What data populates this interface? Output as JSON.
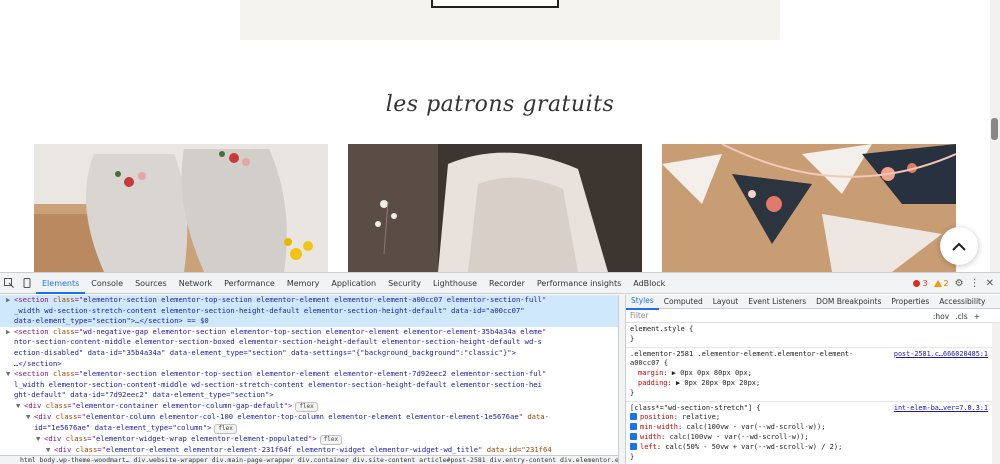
{
  "site": {
    "section_title": "les patrons gratuits",
    "cards": [
      {
        "name": "slippers"
      },
      {
        "name": "knitted-blanket"
      },
      {
        "name": "fabric-garland"
      }
    ],
    "up_icon": "chevron-up-icon"
  },
  "devtools": {
    "tabs": [
      "Elements",
      "Console",
      "Sources",
      "Network",
      "Performance",
      "Memory",
      "Application",
      "Security",
      "Lighthouse",
      "Recorder",
      "Performance insights",
      "AdBlock"
    ],
    "active_tab": "Elements",
    "error_count": "3",
    "warning_count": "2",
    "elements": [
      {
        "tri": "▶",
        "open": "<section ",
        "attrs": [
          [
            "class",
            "elementor-section elementor-top-section elementor-element elementor-element-a00cc07 elementor-section-full"
          ]
        ],
        "indent": 0,
        "selected": true
      },
      {
        "tri": "",
        "text": "_width wd-section-stretch-content elementor-section-height-default elementor-section-height-default\" data-id=\"a00cc07\"",
        "indent": 0,
        "selected": true
      },
      {
        "tri": "",
        "text": "data-element_type=\"section\">…</section> == $0",
        "indent": 0,
        "selected": true
      },
      {
        "tri": "▶",
        "open": "<section ",
        "attrs": [
          [
            "class",
            "wd-negative-gap elementor-section elementor-top-section elementor-element elementor-element-35b4a34a eleme"
          ]
        ],
        "indent": 0
      },
      {
        "tri": "",
        "text": "ntor-section-content-middle elementor-section-boxed elementor-section-height-default elementor-section-height-default wd-s",
        "indent": 0
      },
      {
        "tri": "",
        "text": "ection-disabled\" data-id=\"35b4a34a\" data-element_type=\"section\" data-settings=\"{\"background_background\":\"classic\"}\">",
        "indent": 0
      },
      {
        "tri": "",
        "text": "…</section>",
        "indent": 0
      },
      {
        "tri": "▼",
        "open": "<section ",
        "attrs": [
          [
            "class",
            "elementor-section elementor-top-section elementor-element elementor-element-7d92eec2 elementor-section-ful"
          ]
        ],
        "indent": 0
      },
      {
        "tri": "",
        "text": "l_width elementor-section-content-middle wd-section-stretch-content elementor-section-height-default elementor-section-hei",
        "indent": 0
      },
      {
        "tri": "",
        "text": "ght-default\" data-id=\"7d92eec2\" data-element_type=\"section\">",
        "indent": 0
      },
      {
        "tri": "▼",
        "open": "<div ",
        "attrs": [
          [
            "class",
            "elementor-container elementor-column-gap-default"
          ]
        ],
        "close": ">",
        "badge": "flex",
        "indent": 1
      },
      {
        "tri": "▼",
        "open": "<div ",
        "attrs": [
          [
            "class",
            "elementor-column elementor-col-100 elementor-top-column elementor-element elementor-element-1e5676ae"
          ]
        ],
        "tail": " data-",
        "indent": 2
      },
      {
        "tri": "",
        "text": "id=\"1e5676ae\" data-element_type=\"column\">",
        "badge": "flex",
        "indent": 2
      },
      {
        "tri": "▼",
        "open": "<div ",
        "attrs": [
          [
            "class",
            "elementor-widget-wrap elementor-element-populated"
          ]
        ],
        "close": ">",
        "badge": "flex",
        "indent": 3
      },
      {
        "tri": "▼",
        "open": "<div ",
        "attrs": [
          [
            "class",
            "elementor-element elementor-element-231f64f elementor-widget elementor-widget-wd_title"
          ]
        ],
        "tail": " data-id=\"231f64",
        "indent": 4
      }
    ],
    "breadcrumbs": "html   body.wp-theme-woodmart…   div.website-wrapper   div.main-page-wrapper   div.container   div.site-content   article#post-2581   div.entry-content   div.elementor.elementor-2581   section.elementor-section.elementor-top-section.elementor-element.elementor-el…a00cc07.elementor",
    "styles_tabs": [
      "Styles",
      "Computed",
      "Layout",
      "Event Listeners",
      "DOM Breakpoints",
      "Properties",
      "Accessibility"
    ],
    "styles_active": "Styles",
    "filter_placeholder": "Filter",
    "filter_tools": [
      ":hov",
      ".cls",
      "+"
    ],
    "rules": [
      {
        "selector": "element.style {",
        "props": [],
        "close": "}"
      },
      {
        "selector": ".elementor-2581 .elementor-element.elementor-element-",
        "selector2": "a00cc07 {",
        "source": "post-2581.c…666020485:1",
        "props": [
          [
            "margin",
            "▶ 0px 0px 80px 0px;"
          ],
          [
            "padding",
            "▶ 0px 20px 0px 20px;"
          ]
        ],
        "close": "}"
      },
      {
        "selector": "[class*=\"wd-section-stretch\"] {",
        "source": "int-elem-ba…ver=7.0.3:1",
        "checked": true,
        "props": [
          [
            "position",
            "relative;"
          ],
          [
            "min-width",
            "calc(100vw - var(--wd-scroll-w));"
          ],
          [
            "width",
            "calc(100vw - var(--wd-scroll-w));"
          ],
          [
            "left",
            "calc(50% - 50vw + var(--wd-scroll-w) / 2);"
          ]
        ],
        "close": "}"
      }
    ]
  },
  "colors": {
    "devtools_accent": "#1a73e8",
    "selected_row": "#cfe8fc",
    "tag": "#881280",
    "attr_name": "#994500",
    "attr_value": "#1a1aa6",
    "css_prop": "#c80000"
  }
}
